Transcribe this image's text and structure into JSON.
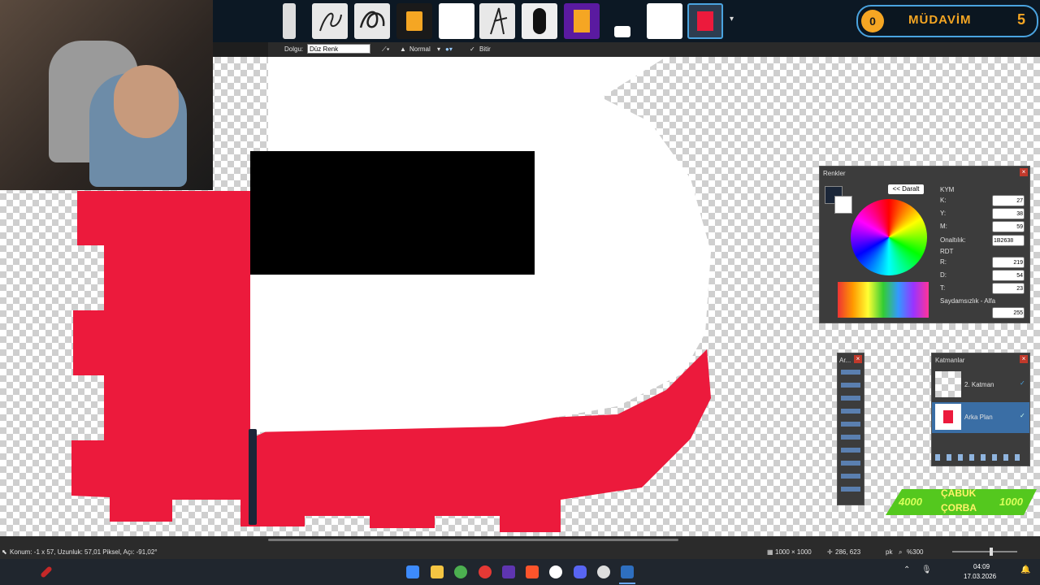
{
  "overlay": {
    "badge_count": "0",
    "badge_label": "MÜDAVİM",
    "badge_level": "5",
    "promo_left": "4000",
    "promo_title_1": "ÇABUK",
    "promo_title_2": "ÇORBA",
    "promo_right": "1000"
  },
  "options": {
    "fill_label": "Dolgu:",
    "fill_value": "Düz Renk",
    "blend_mode": "Normal",
    "finish_label": "Bitir"
  },
  "colors_panel": {
    "title": "Renkler",
    "collapse_label": "<< Daralt",
    "cmy_header": "KYM",
    "k_label": "K:",
    "k_value": "27",
    "y_label": "Y:",
    "y_value": "38",
    "m_label": "M:",
    "m_value": "59",
    "hex_label": "Onaltılık:",
    "hex_value": "1B2638",
    "rgb_header": "RDT",
    "r_label": "R:",
    "r_value": "219",
    "d_label": "D:",
    "d_value": "54",
    "t_label": "T:",
    "t_value": "23",
    "alpha_label": "Saydamsızlık - Alfa",
    "alpha_value": "255"
  },
  "tools_panel": {
    "title": "Ar..."
  },
  "layers_panel": {
    "title": "Katmanlar",
    "layers": [
      {
        "name": "2. Katman"
      },
      {
        "name": "Arka Plan"
      }
    ]
  },
  "status": {
    "position_text": "Konum: -1 x 57, Uzunluk: 57,01 Piksel, Açı: -91,02°",
    "image_size": "1000 × 1000",
    "cursor_pos": "286, 623",
    "unit": "pk",
    "zoom": "%300"
  },
  "taskbar": {
    "time": "04:09",
    "date": "17.03.2026"
  },
  "accent_colors": {
    "red": "#ec1a3c",
    "black": "#000000",
    "panel": "#3c3c3c",
    "selected_layer": "#3a6ea5"
  }
}
